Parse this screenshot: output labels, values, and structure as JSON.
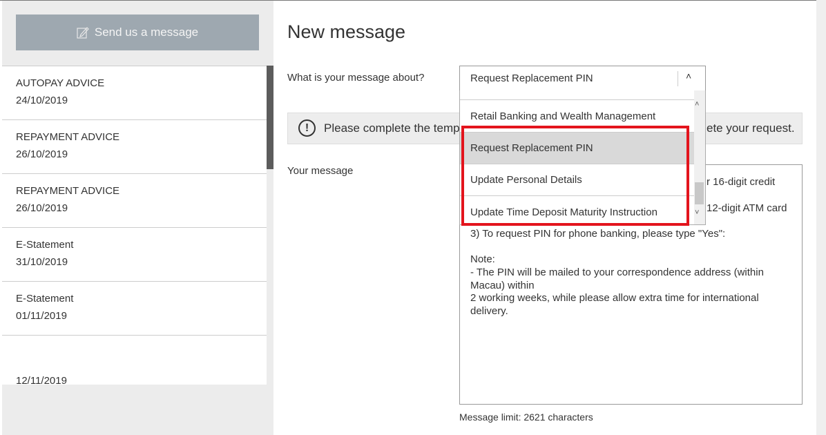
{
  "sidebar": {
    "send_button": "Send us a message",
    "send_icon": "edit-icon",
    "items": [
      {
        "title": "AUTOPAY ADVICE",
        "date": "24/10/2019"
      },
      {
        "title": "REPAYMENT ADVICE",
        "date": "26/10/2019"
      },
      {
        "title": "REPAYMENT ADVICE",
        "date": "26/10/2019"
      },
      {
        "title": "E-Statement",
        "date": "31/10/2019"
      },
      {
        "title": "E-Statement",
        "date": "01/11/2019"
      },
      {
        "title": "",
        "date": "12/11/2019"
      }
    ]
  },
  "main": {
    "title": "New message",
    "topic_label": "What is your message about?",
    "topic_selected": "Request Replacement PIN",
    "topic_options": [
      "Retail Banking and Wealth Management",
      "Request Replacement PIN",
      "Update Personal Details",
      "Update Time Deposit Maturity Instruction"
    ],
    "info_icon": "exclamation-circle-icon",
    "info_text_visible_start": "Please complete the templ",
    "info_text_visible_end": "ete your request.",
    "message_label": "Your message",
    "message_lines_partial": [
      "r 16-digit credit",
      "12-digit ATM card"
    ],
    "message_lines": [
      "3) To request PIN for phone banking, please type \"Yes\":",
      "",
      "Note:",
      "- The PIN will be mailed to your correspondence address (within",
      "Macau) within",
      "2 working weeks, while please allow extra time for international",
      "delivery."
    ],
    "message_limit": "Message limit: 2621 characters"
  },
  "colors": {
    "highlight_box": "#e3141d",
    "send_button_bg": "#9ea8b0",
    "selected_option_bg": "#d9d9d9"
  }
}
